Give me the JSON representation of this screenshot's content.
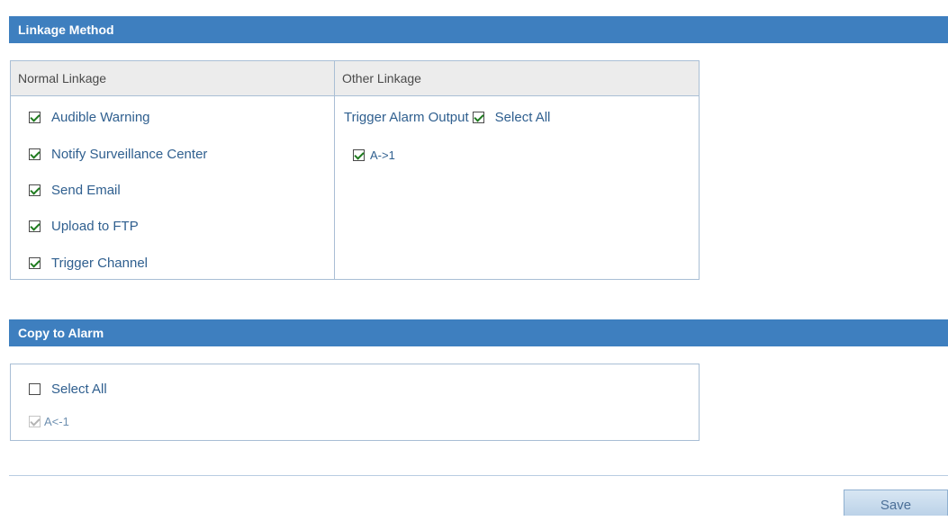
{
  "linkage_method": {
    "title": "Linkage Method",
    "normal": {
      "header": "Normal Linkage",
      "items": [
        {
          "label": "Audible Warning",
          "checked": true
        },
        {
          "label": "Notify Surveillance Center",
          "checked": true
        },
        {
          "label": "Send Email",
          "checked": true
        },
        {
          "label": "Upload to FTP",
          "checked": true
        },
        {
          "label": "Trigger Channel",
          "checked": true
        }
      ]
    },
    "other": {
      "header": "Other Linkage",
      "trigger_label": "Trigger Alarm Output",
      "select_all_label": "Select All",
      "select_all_checked": true,
      "outputs": [
        {
          "label": "A->1",
          "checked": true
        }
      ]
    }
  },
  "copy_to_alarm": {
    "title": "Copy to Alarm",
    "select_all_label": "Select All",
    "select_all_checked": false,
    "alarms": [
      {
        "label": "A<-1",
        "checked": true,
        "disabled": true
      }
    ]
  },
  "footer": {
    "save_label": "Save"
  },
  "colors": {
    "section_bar": "#3e7fbf",
    "header_bg": "#ececec",
    "border": "#a9bed5",
    "label_text": "#2f5f8f",
    "check_mark": "#1f7b1f"
  }
}
